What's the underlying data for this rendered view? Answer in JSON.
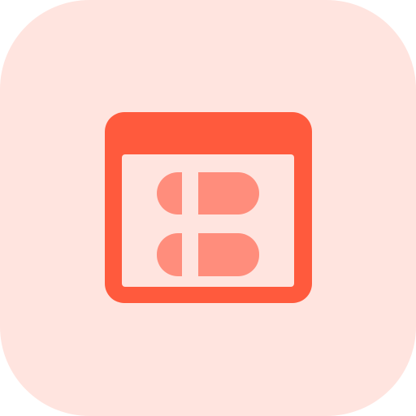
{
  "icon": {
    "name": "browser-window-pills-icon",
    "colors": {
      "tile_background": "#FFE4DF",
      "window_frame": "#FF5A3D",
      "window_body": "#FFE4DF",
      "pill_fill": "#FF8D7C",
      "divider": "#FFE4DF"
    }
  }
}
